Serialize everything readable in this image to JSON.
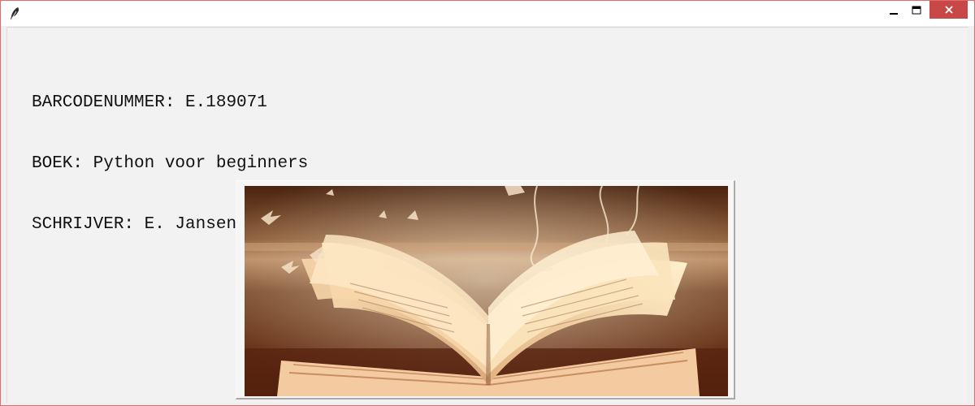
{
  "window": {
    "title": "",
    "controls": {
      "minimize_icon": "minimize-icon",
      "maximize_icon": "maximize-icon",
      "close_icon": "close-icon"
    },
    "close_color": "#c84747",
    "border_color": "#e36b6b"
  },
  "book": {
    "barcode_line": "BARCODENUMMER: E.189071",
    "title_line": "BOEK: Python voor beginners",
    "author_line": "SCHRIJVER: E. Jansen"
  },
  "image": {
    "description_icon": "open-book-photo"
  }
}
